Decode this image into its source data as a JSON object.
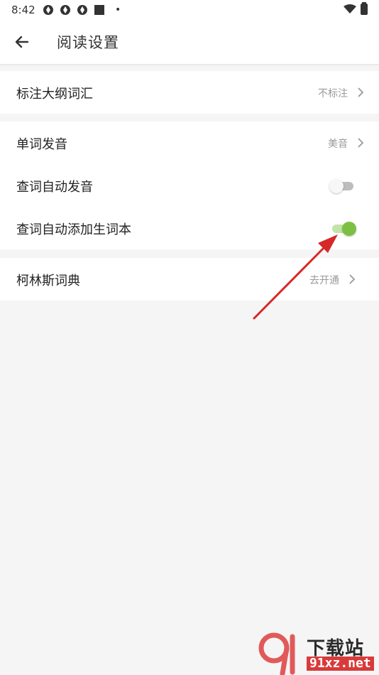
{
  "status_bar": {
    "time": "8:42"
  },
  "app_bar": {
    "title": "阅读设置"
  },
  "groups": [
    {
      "rows": [
        {
          "label": "标注大纲词汇",
          "value": "不标注"
        }
      ]
    },
    {
      "rows": [
        {
          "label": "单词发音",
          "value": "美音"
        },
        {
          "label": "查词自动发音",
          "toggle": false
        },
        {
          "label": "查词自动添加生词本",
          "toggle": true
        }
      ]
    },
    {
      "rows": [
        {
          "label": "柯林斯词典",
          "value": "去开通"
        }
      ]
    }
  ],
  "colors": {
    "toggle_on": "#7cc043",
    "toggle_off": "#bdbdbd",
    "annotation_arrow": "#d62828"
  },
  "watermark": {
    "line1": "下载站",
    "line2": "91xz.net"
  }
}
